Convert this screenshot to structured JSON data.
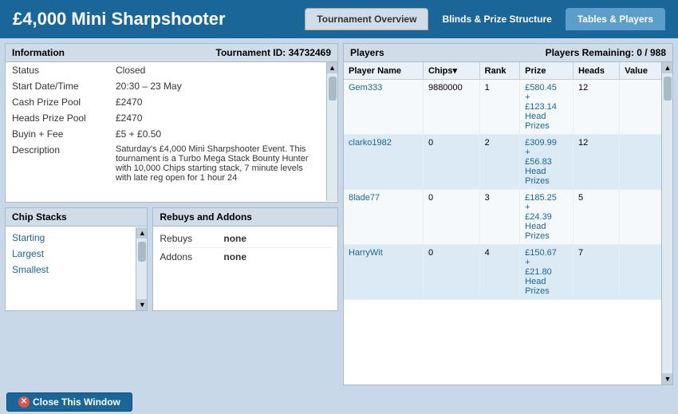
{
  "header": {
    "title": "£4,000 Mini Sharpshooter"
  },
  "tabs": [
    {
      "label": "Tournament Overview",
      "state": "default"
    },
    {
      "label": "Blinds & Prize Structure",
      "state": "active"
    },
    {
      "label": "Tables & Players",
      "state": "light-active"
    }
  ],
  "info_box": {
    "header_left": "Information",
    "header_right": "Tournament ID: 34732469",
    "rows": [
      {
        "label": "Status",
        "value": "Closed"
      },
      {
        "label": "Start Date/Time",
        "value": "20:30 – 23 May"
      },
      {
        "label": "Cash Prize Pool",
        "value": "£2470"
      },
      {
        "label": "Heads Prize Pool",
        "value": "£2470"
      },
      {
        "label": "Buyin + Fee",
        "value": "£5 + £0.50"
      },
      {
        "label": "Description",
        "value": "Saturday's £4,000 Mini Sharpshooter Event. This tournament is a Turbo Mega Stack Bounty Hunter with 10,000 Chips starting stack, 7 minute levels with late reg open for 1 hour 24"
      }
    ]
  },
  "chip_stacks": {
    "header": "Chip Stacks",
    "items": [
      "Starting",
      "Largest",
      "Smallest"
    ]
  },
  "rebuys": {
    "header": "Rebuys and Addons",
    "rows": [
      {
        "label": "Rebuys",
        "value": "none"
      },
      {
        "label": "Addons",
        "value": "none"
      }
    ]
  },
  "players": {
    "header_left": "Players",
    "header_right": "Players Remaining: 0 / 988",
    "columns": [
      "Player Name",
      "Chips▾",
      "Rank",
      "Prize",
      "Heads",
      "Value"
    ],
    "rows": [
      {
        "name": "Gem333",
        "chips": "9880000",
        "rank": "1",
        "prize": "£580.45\n+\n£123.14\nHead\nPrizes",
        "heads": "12",
        "value": ""
      },
      {
        "name": "clarko1982",
        "chips": "0",
        "rank": "2",
        "prize": "£309.99\n+\n£56.83\nHead\nPrizes",
        "heads": "12",
        "value": ""
      },
      {
        "name": "8lade77",
        "chips": "0",
        "rank": "3",
        "prize": "£185.25\n+\n£24.39\nHead\nPrizes",
        "heads": "5",
        "value": ""
      },
      {
        "name": "HarryWit",
        "chips": "0",
        "rank": "4",
        "prize": "£150.67\n+\n£21.80\nHead\nPrizes",
        "heads": "7",
        "value": ""
      }
    ]
  },
  "footer": {
    "close_label": "Close This Window"
  }
}
